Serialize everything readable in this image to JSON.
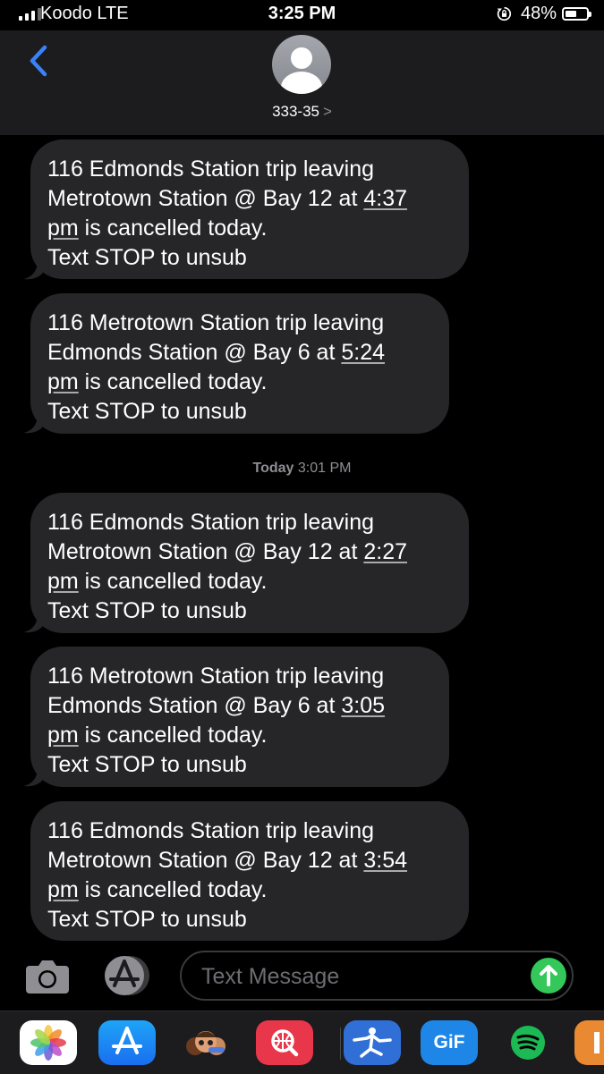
{
  "status": {
    "carrier": "Koodo LTE",
    "time": "3:25 PM",
    "battery": "48%"
  },
  "header": {
    "contact": "333-35",
    "chevron": ">"
  },
  "messages": [
    {
      "line1": "116 Edmonds Station trip leaving",
      "line2": "Metrotown Station @ Bay 12 at ",
      "time_part1": "4:37",
      "time_part2": "pm",
      "line3_rest": " is cancelled today.",
      "line4": "Text STOP to unsub"
    },
    {
      "line1": "116 Metrotown Station trip leaving",
      "line2": "Edmonds Station @ Bay 6 at ",
      "time_part1": "5:24",
      "time_part2": "pm",
      "line3_rest": " is cancelled today.",
      "line4": "Text STOP to unsub"
    },
    {
      "line1": "116 Edmonds Station trip leaving",
      "line2": "Metrotown Station @ Bay 12 at ",
      "time_part1": "2:27",
      "time_part2": "pm",
      "line3_rest": " is cancelled today.",
      "line4": "Text STOP to unsub"
    },
    {
      "line1": "116 Metrotown Station trip leaving",
      "line2": "Edmonds Station @ Bay 6 at ",
      "time_part1": "3:05",
      "time_part2": "pm",
      "line3_rest": " is cancelled today.",
      "line4": "Text STOP to unsub"
    },
    {
      "line1": "116 Edmonds Station trip leaving",
      "line2": "Metrotown Station @ Bay 12 at ",
      "time_part1": "3:54",
      "time_part2": "pm",
      "line3_rest": " is cancelled today.",
      "line4": "Text STOP to unsub"
    }
  ],
  "timestamp": {
    "day": "Today",
    "time": "3:01 PM"
  },
  "compose": {
    "placeholder": "Text Message"
  },
  "app_drawer": [
    {
      "icon": "photos-icon"
    },
    {
      "icon": "app-store-icon"
    },
    {
      "icon": "memoji-icon"
    },
    {
      "icon": "web-search-icon"
    },
    {
      "icon": "fitness-app-icon"
    },
    {
      "icon": "gif-icon",
      "label": "GiF"
    },
    {
      "icon": "spotify-icon"
    },
    {
      "icon": "partial-app-icon"
    }
  ],
  "colors": {
    "bubble": "#262628",
    "accent_blue": "#3a82f7",
    "send_green": "#34c759",
    "header_bg": "#1c1c1e"
  }
}
